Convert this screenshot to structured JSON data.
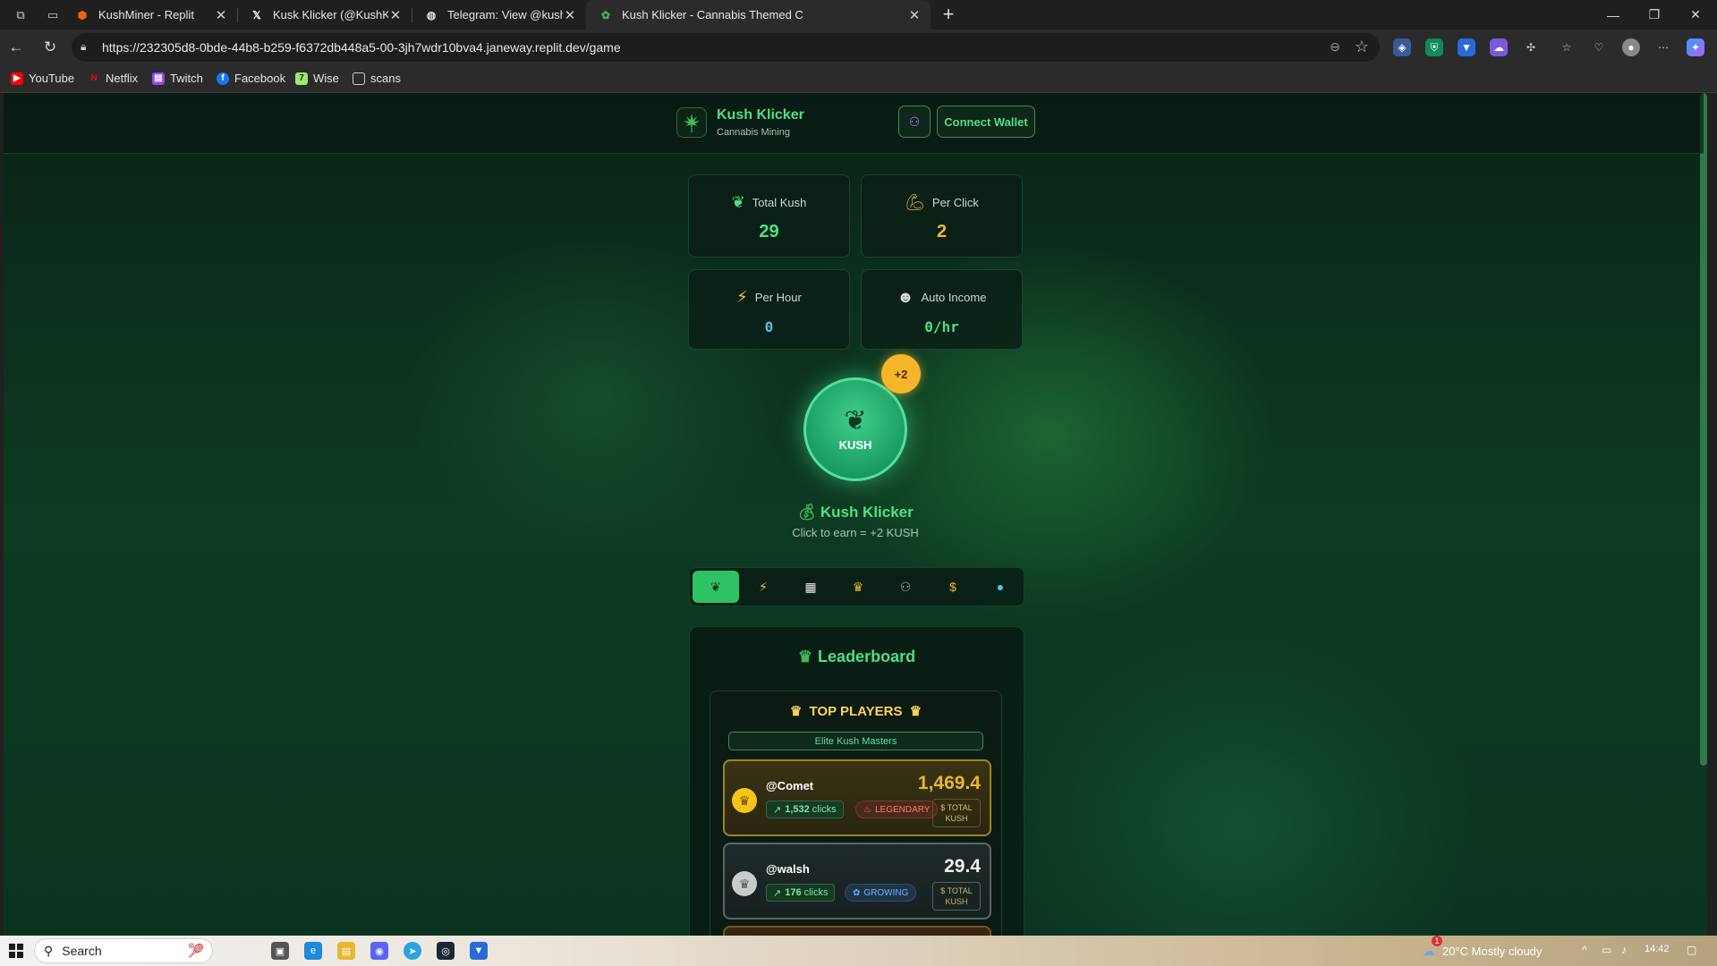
{
  "browser": {
    "tabs": [
      {
        "title": "KushMiner - Replit",
        "favicon": "replit-icon",
        "active": false
      },
      {
        "title": "Kusk Klicker (@KushKlicker) / X",
        "favicon": "x-icon",
        "active": false
      },
      {
        "title": "Telegram: View @kushklicker",
        "favicon": "globe-icon",
        "active": false
      },
      {
        "title": "Kush Klicker - Cannabis Themed C",
        "favicon": "kush-leaf-icon",
        "active": true
      }
    ],
    "url": "https://232305d8-0bde-44b8-b259-f6372db448a5-00-3jh7wdr10bva4.janeway.replit.dev/game",
    "bookmarks": [
      {
        "label": "YouTube",
        "icon": "youtube-icon",
        "color": "#ff0000"
      },
      {
        "label": "Netflix",
        "icon": "netflix-icon",
        "color": "#e50914"
      },
      {
        "label": "Twitch",
        "icon": "twitch-icon",
        "color": "#9146ff"
      },
      {
        "label": "Facebook",
        "icon": "facebook-icon",
        "color": "#1877f2"
      },
      {
        "label": "Wise",
        "icon": "wise-icon",
        "color": "#9fe870"
      },
      {
        "label": "scans",
        "icon": "folder-icon",
        "color": "#cccccc"
      }
    ]
  },
  "header": {
    "title": "Kush Klicker",
    "subtitle": "Cannabis Mining",
    "wallet_label": "Connect Wallet"
  },
  "stats": [
    {
      "label": "Total Kush",
      "value": "29",
      "icon": "leaf-icon",
      "color": "#4ee083"
    },
    {
      "label": "Per Click",
      "value": "2",
      "icon": "flexed-arm-icon",
      "color": "#f5b733"
    },
    {
      "label": "Per Hour",
      "value": "0",
      "icon": "lightning-icon",
      "color": "#5ab8e8"
    },
    {
      "label": "Auto Income",
      "value": "0/hr",
      "icon": "robot-icon",
      "color": "#4ee083"
    }
  ],
  "clicker": {
    "button_label": "KUSH",
    "bonus": "+2",
    "title": "Kush Klicker",
    "subtitle": "Click to earn = +2 KUSH"
  },
  "menu": [
    {
      "icon": "leaf-icon",
      "active": true
    },
    {
      "icon": "lightning-icon",
      "active": false
    },
    {
      "icon": "store-icon",
      "active": false
    },
    {
      "icon": "trophy-icon",
      "active": false
    },
    {
      "icon": "users-icon",
      "active": false
    },
    {
      "icon": "money-bag-icon",
      "active": false
    },
    {
      "icon": "globe-icon",
      "active": false
    }
  ],
  "leaderboard": {
    "title": "Leaderboard",
    "top_players": "TOP PLAYERS",
    "tagline": "Elite Kush Masters",
    "players": [
      {
        "name": "@Comet",
        "score": "1,469.4",
        "clicks": "1,532",
        "clicks_suffix": "clicks",
        "rank": "LEGENDARY",
        "total_label_1": "TOTAL",
        "total_label_2": "KUSH"
      },
      {
        "name": "@walsh",
        "score": "29.4",
        "clicks": "176",
        "clicks_suffix": "clicks",
        "rank": "GROWING",
        "total_label_1": "TOTAL",
        "total_label_2": "KUSH"
      }
    ]
  },
  "taskbar": {
    "search_placeholder": "Search",
    "weather": "20°C  Mostly cloudy",
    "notification_count": "1",
    "time": "14:42"
  }
}
